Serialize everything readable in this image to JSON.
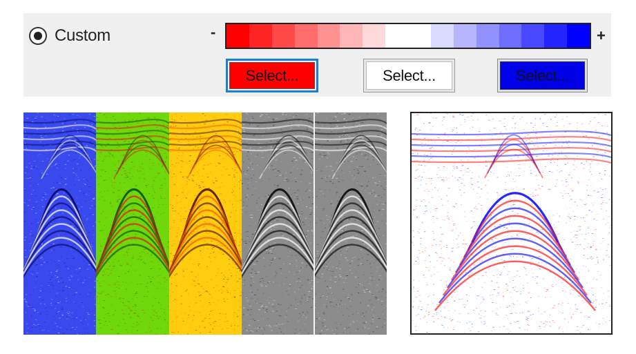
{
  "colormap": {
    "mode_label": "Custom",
    "mode_selected": true,
    "min_sign": "-",
    "max_sign": "+",
    "ramp_colors": [
      "#ff0000",
      "#ff2424",
      "#ff4848",
      "#ff6d6d",
      "#ff9191",
      "#ffb6b6",
      "#ffdada",
      "#ffffff",
      "#ffffff",
      "#dadaff",
      "#b6b6ff",
      "#9191ff",
      "#6d6dff",
      "#4848ff",
      "#2424ff",
      "#0000ff"
    ],
    "buttons": {
      "low": {
        "label": "Select...",
        "color": "#ff0000"
      },
      "mid": {
        "label": "Select...",
        "color": "#ffffff"
      },
      "high": {
        "label": "Select...",
        "color": "#0000ff"
      }
    }
  },
  "images": {
    "strips": [
      {
        "colormap": "blue-white",
        "bg": "#3a49ee",
        "pos": "#ffffff",
        "neg": "#0d0d70"
      },
      {
        "colormap": "green-red",
        "bg": "#6fd80a",
        "pos": "#e11c16",
        "neg": "#0d5a12"
      },
      {
        "colormap": "yellow-orange",
        "bg": "#ffcc10",
        "pos": "#ff5a00",
        "neg": "#5a1c00"
      },
      {
        "colormap": "grayscale",
        "bg": "#8c8c8c",
        "pos": "#ffffff",
        "neg": "#111111"
      },
      {
        "colormap": "grayscale",
        "bg": "#8c8c8c",
        "pos": "#ffffff",
        "neg": "#111111"
      }
    ],
    "preview": {
      "colormap": "custom red-white-blue",
      "bg": "#ffffff",
      "pos": "#ff1a1a",
      "neg": "#1a1aff"
    }
  }
}
